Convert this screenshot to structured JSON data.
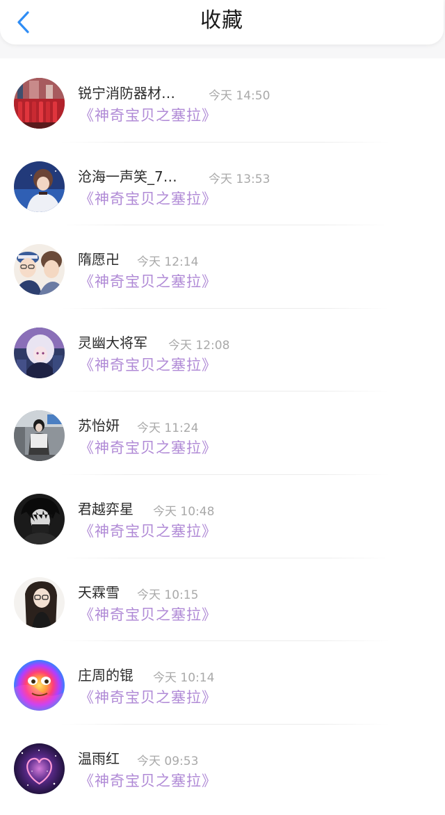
{
  "header": {
    "title": "收藏",
    "back_icon": "chevron-left-icon",
    "accent_color": "#2f8df5"
  },
  "colors": {
    "link": "#b08ad6",
    "time": "#a9a9a9",
    "name": "#2b2b2b"
  },
  "items": [
    {
      "name": "锐宁消防器材…",
      "time": "今天 14:50",
      "link": "《神奇宝贝之塞拉》",
      "avatar": "fire-equipment-photo"
    },
    {
      "name": "沧海一声笑_7…",
      "time": "今天 13:53",
      "link": "《神奇宝贝之塞拉》",
      "avatar": "anime-boy-night-sky"
    },
    {
      "name": "隋愿卍",
      "time": "今天 12:14",
      "link": "《神奇宝贝之塞拉》",
      "avatar": "anime-two-boys"
    },
    {
      "name": "灵幽大将军",
      "time": "今天 12:08",
      "link": "《神奇宝贝之塞拉》",
      "avatar": "anime-girl-white-hair"
    },
    {
      "name": "苏怡妍",
      "time": "今天 11:24",
      "link": "《神奇宝贝之塞拉》",
      "avatar": "girl-street-photo"
    },
    {
      "name": "君越弈星",
      "time": "今天 10:48",
      "link": "《神奇宝贝之塞拉》",
      "avatar": "manga-boy-monochrome"
    },
    {
      "name": "天霖雪",
      "time": "今天 10:15",
      "link": "《神奇宝贝之塞拉》",
      "avatar": "anime-girl-glasses"
    },
    {
      "name": "庄周的锟",
      "time": "今天 10:14",
      "link": "《神奇宝贝之塞拉》",
      "avatar": "rainbow-face"
    },
    {
      "name": "温雨红",
      "time": "今天 09:53",
      "link": "《神奇宝贝之塞拉》",
      "avatar": "galaxy-heart"
    }
  ]
}
